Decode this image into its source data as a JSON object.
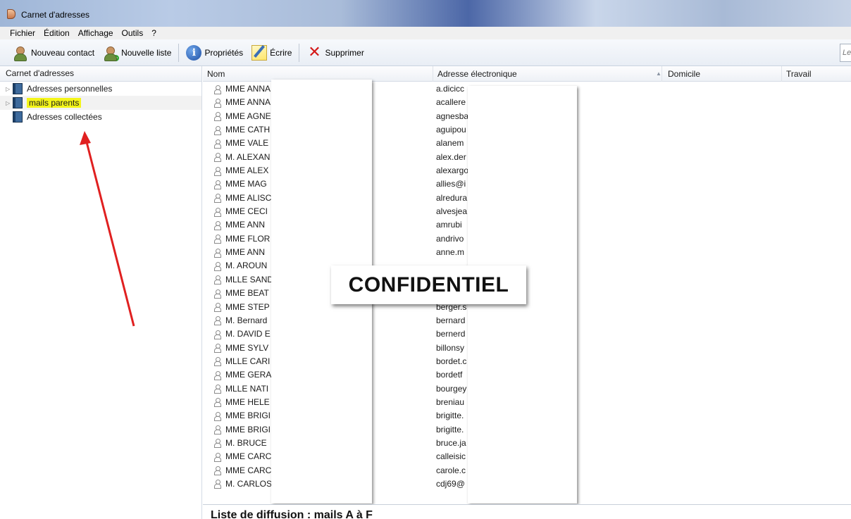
{
  "window": {
    "title": "Carnet d'adresses"
  },
  "menu": [
    {
      "label": "Fichier"
    },
    {
      "label": "Édition"
    },
    {
      "label": "Affichage"
    },
    {
      "label": "Outils"
    },
    {
      "label": "?"
    }
  ],
  "toolbar": {
    "new_contact": "Nouveau contact",
    "new_list": "Nouvelle liste",
    "properties": "Propriétés",
    "write": "Écrire",
    "delete": "Supprimer",
    "search_placeholder": "Le"
  },
  "left_pane": {
    "header": "Carnet d'adresses",
    "items": [
      {
        "label": "Adresses personnelles"
      },
      {
        "label": "mails parents"
      },
      {
        "label": "Adresses collectées"
      }
    ]
  },
  "columns": {
    "name": "Nom",
    "email": "Adresse électronique",
    "home": "Domicile",
    "work": "Travail"
  },
  "contacts": [
    {
      "name": "MME ANNA",
      "email": "a.dicicc"
    },
    {
      "name": "MME ANNA",
      "email": "acallere"
    },
    {
      "name": "MME AGNE",
      "email": "agnesba"
    },
    {
      "name": "MME CATH",
      "email": "aguipou"
    },
    {
      "name": "MME VALE",
      "email": "alanem"
    },
    {
      "name": "M. ALEXAN",
      "email": "alex.der"
    },
    {
      "name": "MME ALEX",
      "email": "alexargo"
    },
    {
      "name": "MME MAG",
      "email": "allies@i"
    },
    {
      "name": "MME ALISC",
      "email": "alredura"
    },
    {
      "name": "MME CECI",
      "email": "alvesjea"
    },
    {
      "name": "MME ANN",
      "email": "amrubi"
    },
    {
      "name": "MME FLOR",
      "email": "andrivo"
    },
    {
      "name": "MME ANN",
      "email": "anne.m"
    },
    {
      "name": "M. AROUN",
      "email": ""
    },
    {
      "name": "MLLE SAND",
      "email": ""
    },
    {
      "name": "MME BEAT",
      "email": ""
    },
    {
      "name": "MME STEP",
      "email": "berger.s"
    },
    {
      "name": "M. Bernard",
      "email": "bernard"
    },
    {
      "name": "M. DAVID E",
      "email": "bernerd"
    },
    {
      "name": "MME SYLV",
      "email": "billonsy"
    },
    {
      "name": "MLLE CARI",
      "email": "bordet.c"
    },
    {
      "name": "MME GERA",
      "email": "bordetf"
    },
    {
      "name": "MLLE NATI",
      "email": "bourgey"
    },
    {
      "name": "MME HELE",
      "email": "breniau"
    },
    {
      "name": "MME BRIGI",
      "email": "brigitte."
    },
    {
      "name": "MME BRIGI",
      "email": "brigitte."
    },
    {
      "name": "M. BRUCE",
      "email": "bruce.ja"
    },
    {
      "name": "MME CARC",
      "email": "calleisic"
    },
    {
      "name": "MME CARC",
      "email": "carole.c"
    },
    {
      "name": "M. CARLOS",
      "email": "cdj69@"
    }
  ],
  "overlay": {
    "stamp": "CONFIDENTIEL"
  },
  "footer": {
    "list_title": "Liste de diffusion : mails A à F"
  },
  "colors": {
    "highlight": "#f4f51a",
    "arrow": "#e02020"
  }
}
